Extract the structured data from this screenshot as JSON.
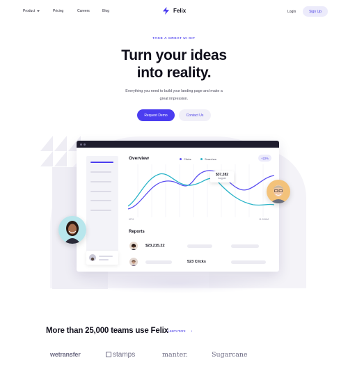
{
  "nav": {
    "items": [
      "Product",
      "Pricing",
      "Careers",
      "Blog"
    ],
    "brand": "Felix",
    "login": "Login",
    "signup": "Sign Up"
  },
  "hero": {
    "eyebrow": "TAKE A GREAT UI KIT",
    "headline_line1": "Turn your ideas",
    "headline_line2": "into reality.",
    "subtext": "Everything you need to build your landing page and make a great impression.",
    "primary_cta": "Request Demo",
    "secondary_cta": "Contact Us"
  },
  "dashboard": {
    "overview_title": "Overview",
    "legend": [
      {
        "label": "Clicks",
        "color": "#5b4ff0"
      },
      {
        "label": "Searches",
        "color": "#2bb4c8"
      }
    ],
    "badge": "+22%",
    "tooltip_value": "$37,282",
    "tooltip_label": "August",
    "axis_start": "6PM",
    "axis_end": "11:59AM",
    "reports_title": "Reports",
    "report_value_1": "$23,215.22",
    "report_value_2": "523 Clicks"
  },
  "social_proof": {
    "headline": "More than 25,000 teams use Felix",
    "learn_more": "Learn more",
    "arrow": "›",
    "logos": [
      "wetransfer",
      "stamps",
      "manter.",
      "Sugarcane"
    ]
  },
  "colors": {
    "accent": "#4b3df0",
    "accent_soft": "#ecebfb",
    "teal": "#2bb4c8"
  }
}
